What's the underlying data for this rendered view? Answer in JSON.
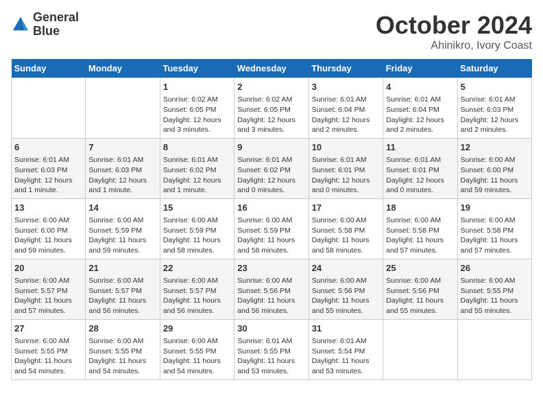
{
  "logo": {
    "line1": "General",
    "line2": "Blue"
  },
  "title": "October 2024",
  "subtitle": "Ahinikro, Ivory Coast",
  "weekdays": [
    "Sunday",
    "Monday",
    "Tuesday",
    "Wednesday",
    "Thursday",
    "Friday",
    "Saturday"
  ],
  "weeks": [
    [
      {
        "day": "",
        "info": ""
      },
      {
        "day": "",
        "info": ""
      },
      {
        "day": "1",
        "info": "Sunrise: 6:02 AM\nSunset: 6:05 PM\nDaylight: 12 hours and 3 minutes."
      },
      {
        "day": "2",
        "info": "Sunrise: 6:02 AM\nSunset: 6:05 PM\nDaylight: 12 hours and 3 minutes."
      },
      {
        "day": "3",
        "info": "Sunrise: 6:01 AM\nSunset: 6:04 PM\nDaylight: 12 hours and 2 minutes."
      },
      {
        "day": "4",
        "info": "Sunrise: 6:01 AM\nSunset: 6:04 PM\nDaylight: 12 hours and 2 minutes."
      },
      {
        "day": "5",
        "info": "Sunrise: 6:01 AM\nSunset: 6:03 PM\nDaylight: 12 hours and 2 minutes."
      }
    ],
    [
      {
        "day": "6",
        "info": "Sunrise: 6:01 AM\nSunset: 6:03 PM\nDaylight: 12 hours and 1 minute."
      },
      {
        "day": "7",
        "info": "Sunrise: 6:01 AM\nSunset: 6:03 PM\nDaylight: 12 hours and 1 minute."
      },
      {
        "day": "8",
        "info": "Sunrise: 6:01 AM\nSunset: 6:02 PM\nDaylight: 12 hours and 1 minute."
      },
      {
        "day": "9",
        "info": "Sunrise: 6:01 AM\nSunset: 6:02 PM\nDaylight: 12 hours and 0 minutes."
      },
      {
        "day": "10",
        "info": "Sunrise: 6:01 AM\nSunset: 6:01 PM\nDaylight: 12 hours and 0 minutes."
      },
      {
        "day": "11",
        "info": "Sunrise: 6:01 AM\nSunset: 6:01 PM\nDaylight: 12 hours and 0 minutes."
      },
      {
        "day": "12",
        "info": "Sunrise: 6:00 AM\nSunset: 6:00 PM\nDaylight: 11 hours and 59 minutes."
      }
    ],
    [
      {
        "day": "13",
        "info": "Sunrise: 6:00 AM\nSunset: 6:00 PM\nDaylight: 11 hours and 59 minutes."
      },
      {
        "day": "14",
        "info": "Sunrise: 6:00 AM\nSunset: 5:59 PM\nDaylight: 11 hours and 59 minutes."
      },
      {
        "day": "15",
        "info": "Sunrise: 6:00 AM\nSunset: 5:59 PM\nDaylight: 11 hours and 58 minutes."
      },
      {
        "day": "16",
        "info": "Sunrise: 6:00 AM\nSunset: 5:59 PM\nDaylight: 11 hours and 58 minutes."
      },
      {
        "day": "17",
        "info": "Sunrise: 6:00 AM\nSunset: 5:58 PM\nDaylight: 11 hours and 58 minutes."
      },
      {
        "day": "18",
        "info": "Sunrise: 6:00 AM\nSunset: 5:58 PM\nDaylight: 11 hours and 57 minutes."
      },
      {
        "day": "19",
        "info": "Sunrise: 6:00 AM\nSunset: 5:58 PM\nDaylight: 11 hours and 57 minutes."
      }
    ],
    [
      {
        "day": "20",
        "info": "Sunrise: 6:00 AM\nSunset: 5:57 PM\nDaylight: 11 hours and 57 minutes."
      },
      {
        "day": "21",
        "info": "Sunrise: 6:00 AM\nSunset: 5:57 PM\nDaylight: 11 hours and 56 minutes."
      },
      {
        "day": "22",
        "info": "Sunrise: 6:00 AM\nSunset: 5:57 PM\nDaylight: 11 hours and 56 minutes."
      },
      {
        "day": "23",
        "info": "Sunrise: 6:00 AM\nSunset: 5:56 PM\nDaylight: 11 hours and 56 minutes."
      },
      {
        "day": "24",
        "info": "Sunrise: 6:00 AM\nSunset: 5:56 PM\nDaylight: 11 hours and 55 minutes."
      },
      {
        "day": "25",
        "info": "Sunrise: 6:00 AM\nSunset: 5:56 PM\nDaylight: 11 hours and 55 minutes."
      },
      {
        "day": "26",
        "info": "Sunrise: 6:00 AM\nSunset: 5:55 PM\nDaylight: 11 hours and 55 minutes."
      }
    ],
    [
      {
        "day": "27",
        "info": "Sunrise: 6:00 AM\nSunset: 5:55 PM\nDaylight: 11 hours and 54 minutes."
      },
      {
        "day": "28",
        "info": "Sunrise: 6:00 AM\nSunset: 5:55 PM\nDaylight: 11 hours and 54 minutes."
      },
      {
        "day": "29",
        "info": "Sunrise: 6:00 AM\nSunset: 5:55 PM\nDaylight: 11 hours and 54 minutes."
      },
      {
        "day": "30",
        "info": "Sunrise: 6:01 AM\nSunset: 5:55 PM\nDaylight: 11 hours and 53 minutes."
      },
      {
        "day": "31",
        "info": "Sunrise: 6:01 AM\nSunset: 5:54 PM\nDaylight: 11 hours and 53 minutes."
      },
      {
        "day": "",
        "info": ""
      },
      {
        "day": "",
        "info": ""
      }
    ]
  ]
}
